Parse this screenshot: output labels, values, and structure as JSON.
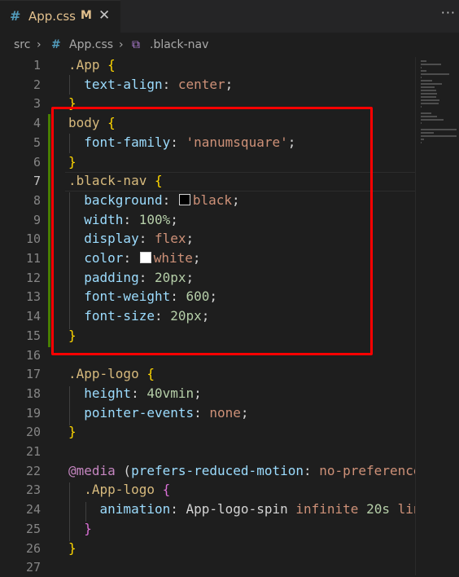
{
  "tab": {
    "icon_glyph": "#",
    "icon_name": "css-file-icon",
    "label": "App.css",
    "modified_badge": "M",
    "close_glyph": "✕"
  },
  "more_actions_glyph": "···",
  "breadcrumb": {
    "folder": "src",
    "separator": "›",
    "file_icon_glyph": "#",
    "file": "App.css",
    "symbol_icon_glyph": "⧉",
    "symbol": ".black-nav"
  },
  "colors": {
    "editor_bg": "#1e1e1e",
    "highlight_box": "#ff0000",
    "git_modified": "#487e02"
  },
  "editor": {
    "active_line": 7,
    "lines": [
      {
        "n": "1",
        "tokens": [
          {
            "t": ".App",
            "c": "sel"
          },
          {
            "t": " ",
            "c": "pun"
          },
          {
            "t": "{",
            "c": "br"
          }
        ]
      },
      {
        "n": "2",
        "tokens": [
          {
            "t": "  ",
            "c": "pun"
          },
          {
            "t": "text-align",
            "c": "prop"
          },
          {
            "t": ": ",
            "c": "pun"
          },
          {
            "t": "center",
            "c": "val"
          },
          {
            "t": ";",
            "c": "pun"
          }
        ]
      },
      {
        "n": "3",
        "tokens": [
          {
            "t": "}",
            "c": "br"
          }
        ]
      },
      {
        "n": "4",
        "tokens": [
          {
            "t": "body",
            "c": "tag"
          },
          {
            "t": " ",
            "c": "pun"
          },
          {
            "t": "{",
            "c": "br"
          }
        ]
      },
      {
        "n": "5",
        "tokens": [
          {
            "t": "  ",
            "c": "pun"
          },
          {
            "t": "font-family",
            "c": "prop"
          },
          {
            "t": ": ",
            "c": "pun"
          },
          {
            "t": "'nanumsquare'",
            "c": "val"
          },
          {
            "t": ";",
            "c": "pun"
          }
        ]
      },
      {
        "n": "6",
        "tokens": [
          {
            "t": "}",
            "c": "br"
          }
        ]
      },
      {
        "n": "7",
        "tokens": [
          {
            "t": ".black-nav",
            "c": "sel"
          },
          {
            "t": " ",
            "c": "pun"
          },
          {
            "t": "{",
            "c": "br"
          }
        ]
      },
      {
        "n": "8",
        "tokens": [
          {
            "t": "  ",
            "c": "pun"
          },
          {
            "t": "background",
            "c": "prop"
          },
          {
            "t": ": ",
            "c": "pun"
          },
          {
            "swatch": "#000000"
          },
          {
            "t": "black",
            "c": "val"
          },
          {
            "t": ";",
            "c": "pun"
          }
        ]
      },
      {
        "n": "9",
        "tokens": [
          {
            "t": "  ",
            "c": "pun"
          },
          {
            "t": "width",
            "c": "prop"
          },
          {
            "t": ": ",
            "c": "pun"
          },
          {
            "t": "100%",
            "c": "num"
          },
          {
            "t": ";",
            "c": "pun"
          }
        ]
      },
      {
        "n": "10",
        "tokens": [
          {
            "t": "  ",
            "c": "pun"
          },
          {
            "t": "display",
            "c": "prop"
          },
          {
            "t": ": ",
            "c": "pun"
          },
          {
            "t": "flex",
            "c": "val"
          },
          {
            "t": ";",
            "c": "pun"
          }
        ]
      },
      {
        "n": "11",
        "tokens": [
          {
            "t": "  ",
            "c": "pun"
          },
          {
            "t": "color",
            "c": "prop"
          },
          {
            "t": ": ",
            "c": "pun"
          },
          {
            "swatch": "#ffffff"
          },
          {
            "t": "white",
            "c": "val"
          },
          {
            "t": ";",
            "c": "pun"
          }
        ]
      },
      {
        "n": "12",
        "tokens": [
          {
            "t": "  ",
            "c": "pun"
          },
          {
            "t": "padding",
            "c": "prop"
          },
          {
            "t": ": ",
            "c": "pun"
          },
          {
            "t": "20px",
            "c": "num"
          },
          {
            "t": ";",
            "c": "pun"
          }
        ]
      },
      {
        "n": "13",
        "tokens": [
          {
            "t": "  ",
            "c": "pun"
          },
          {
            "t": "font-weight",
            "c": "prop"
          },
          {
            "t": ": ",
            "c": "pun"
          },
          {
            "t": "600",
            "c": "num"
          },
          {
            "t": ";",
            "c": "pun"
          }
        ]
      },
      {
        "n": "14",
        "tokens": [
          {
            "t": "  ",
            "c": "pun"
          },
          {
            "t": "font-size",
            "c": "prop"
          },
          {
            "t": ": ",
            "c": "pun"
          },
          {
            "t": "20px",
            "c": "num"
          },
          {
            "t": ";",
            "c": "pun"
          }
        ]
      },
      {
        "n": "15",
        "tokens": [
          {
            "t": "}",
            "c": "br"
          }
        ]
      },
      {
        "n": "16",
        "tokens": []
      },
      {
        "n": "17",
        "tokens": [
          {
            "t": ".App-logo",
            "c": "sel"
          },
          {
            "t": " ",
            "c": "pun"
          },
          {
            "t": "{",
            "c": "br"
          }
        ]
      },
      {
        "n": "18",
        "tokens": [
          {
            "t": "  ",
            "c": "pun"
          },
          {
            "t": "height",
            "c": "prop"
          },
          {
            "t": ": ",
            "c": "pun"
          },
          {
            "t": "40vmin",
            "c": "num"
          },
          {
            "t": ";",
            "c": "pun"
          }
        ]
      },
      {
        "n": "19",
        "tokens": [
          {
            "t": "  ",
            "c": "pun"
          },
          {
            "t": "pointer-events",
            "c": "prop"
          },
          {
            "t": ": ",
            "c": "pun"
          },
          {
            "t": "none",
            "c": "val"
          },
          {
            "t": ";",
            "c": "pun"
          }
        ]
      },
      {
        "n": "20",
        "tokens": [
          {
            "t": "}",
            "c": "br"
          }
        ]
      },
      {
        "n": "21",
        "tokens": []
      },
      {
        "n": "22",
        "tokens": [
          {
            "t": "@media",
            "c": "at"
          },
          {
            "t": " (",
            "c": "pun"
          },
          {
            "t": "prefers-reduced-motion",
            "c": "prop"
          },
          {
            "t": ": ",
            "c": "pun"
          },
          {
            "t": "no-preference",
            "c": "val"
          }
        ]
      },
      {
        "n": "23",
        "tokens": [
          {
            "t": "  ",
            "c": "pun"
          },
          {
            "t": ".App-logo",
            "c": "sel"
          },
          {
            "t": " ",
            "c": "pun"
          },
          {
            "t": "{",
            "c": "br2"
          }
        ]
      },
      {
        "n": "24",
        "tokens": [
          {
            "t": "    ",
            "c": "pun"
          },
          {
            "t": "animation",
            "c": "prop"
          },
          {
            "t": ": ",
            "c": "pun"
          },
          {
            "t": "App-logo-spin",
            "c": "pun"
          },
          {
            "t": " ",
            "c": "pun"
          },
          {
            "t": "infinite",
            "c": "val"
          },
          {
            "t": " ",
            "c": "pun"
          },
          {
            "t": "20s",
            "c": "num"
          },
          {
            "t": " ",
            "c": "pun"
          },
          {
            "t": "lin",
            "c": "val"
          }
        ]
      },
      {
        "n": "25",
        "tokens": [
          {
            "t": "  ",
            "c": "pun"
          },
          {
            "t": "}",
            "c": "br2"
          }
        ]
      },
      {
        "n": "26",
        "tokens": [
          {
            "t": "}",
            "c": "br"
          }
        ]
      },
      {
        "n": "27",
        "tokens": []
      }
    ]
  }
}
